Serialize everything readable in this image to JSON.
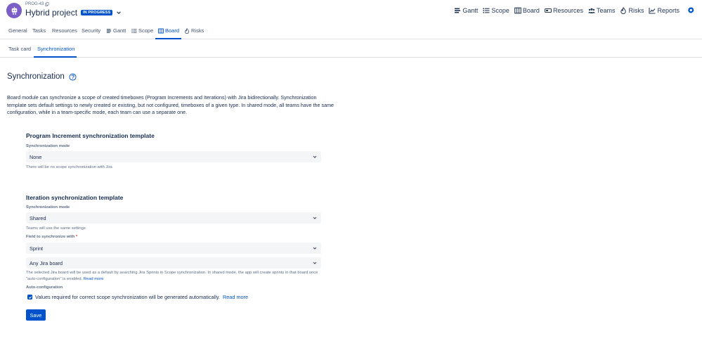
{
  "header": {
    "project_key": "PROG-43",
    "project_title": "Hybrid project",
    "status": "IN PROGRESS",
    "nav": [
      {
        "label": "Gantt",
        "icon": "gantt-icon"
      },
      {
        "label": "Scope",
        "icon": "list-icon"
      },
      {
        "label": "Board",
        "icon": "board-icon"
      },
      {
        "label": "Resources",
        "icon": "resources-icon"
      },
      {
        "label": "Teams",
        "icon": "teams-icon"
      },
      {
        "label": "Risks",
        "icon": "fire-icon"
      },
      {
        "label": "Reports",
        "icon": "reports-icon"
      }
    ]
  },
  "tabs": [
    {
      "label": "General"
    },
    {
      "label": "Tasks"
    },
    {
      "label": "Resources"
    },
    {
      "label": "Security"
    },
    {
      "label": "Gantt",
      "icon": "gantt-icon"
    },
    {
      "label": "Scope",
      "icon": "list-icon"
    },
    {
      "label": "Board",
      "icon": "board-icon",
      "active": true
    },
    {
      "label": "Risks",
      "icon": "fire-icon"
    }
  ],
  "subtabs": [
    {
      "label": "Task card"
    },
    {
      "label": "Synchronization",
      "active": true
    }
  ],
  "page": {
    "title": "Synchronization",
    "intro": "Board module can synchronize a scope of created timeboxes (Program Increments and Iterations) with Jira bidirectionally. Synchronization template sets default settings to newly created or existing, but not configured, timeboxes of a given type. In shared mode, all teams have the same configuration, while in a team-specific mode, each team can use a separate one."
  },
  "pi_section": {
    "heading": "Program Increment synchronization template",
    "mode_label": "Synchronization mode",
    "mode_value": "None",
    "mode_helper": "There will be no scope synchronization with Jira"
  },
  "iteration_section": {
    "heading": "Iteration synchronization template",
    "mode_label": "Synchronization mode",
    "mode_value": "Shared",
    "mode_helper": "Teams will use the same settings",
    "field_label": "Field to synchronize with",
    "field_required": "*",
    "field_value": "Sprint",
    "board_value": "Any Jira board",
    "board_helper": "The selected Jira board will be used as a default by searching Jira Sprints in Scope synchronization. In shared mode, the app will create sprints in that board once \"auto-configuration\" is enabled.",
    "board_helper_link": "Read more",
    "auto_label": "Auto-configuration",
    "auto_checkbox_label": "Values required for correct scope synchronization will be generated automatically.",
    "auto_checkbox_checked": true,
    "auto_link": "Read more"
  },
  "save_label": "Save",
  "colors": {
    "primary": "#0052cc",
    "avatar": "#7b5ec6",
    "text": "#172b4d",
    "muted": "#5e6c84",
    "field_bg": "#f4f5f7"
  }
}
